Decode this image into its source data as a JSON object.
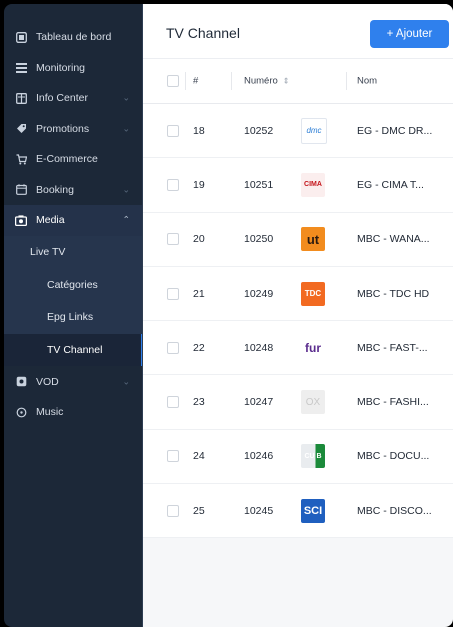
{
  "sidebar": {
    "items": [
      {
        "label": "Tableau de bord",
        "icon": "dashboard-icon",
        "chevron": false
      },
      {
        "label": "Monitoring",
        "icon": "list-icon",
        "chevron": false
      },
      {
        "label": "Info Center",
        "icon": "info-center-icon",
        "chevron": true
      },
      {
        "label": "Promotions",
        "icon": "tag-icon",
        "chevron": true
      },
      {
        "label": "E-Commerce",
        "icon": "cart-icon",
        "chevron": false
      },
      {
        "label": "Booking",
        "icon": "calendar-icon",
        "chevron": true
      },
      {
        "label": "Media",
        "icon": "media-icon",
        "chevron": true,
        "active": true
      }
    ],
    "media_sub": {
      "live_tv": "Live TV",
      "children": [
        "Catégories",
        "Epg Links",
        "TV Channel"
      ]
    },
    "bottom_items": [
      {
        "label": "VOD",
        "icon": "vod-icon",
        "chevron": true
      },
      {
        "label": "Music",
        "icon": "music-icon",
        "chevron": false
      }
    ]
  },
  "header": {
    "title": "TV Channel",
    "add_label": "+ Ajouter"
  },
  "table": {
    "columns": {
      "idx": "#",
      "numero": "Numéro",
      "nom": "Nom"
    },
    "rows": [
      {
        "idx": "18",
        "numero": "10252",
        "nom": "EG - DMC DR...",
        "logo": "dmc"
      },
      {
        "idx": "19",
        "numero": "10251",
        "nom": "EG - CIMA T...",
        "logo": "cima"
      },
      {
        "idx": "20",
        "numero": "10250",
        "nom": "MBC - WANA...",
        "logo": "wanasah"
      },
      {
        "idx": "21",
        "numero": "10249",
        "nom": "MBC - TDC HD",
        "logo": "tdc"
      },
      {
        "idx": "22",
        "numero": "10248",
        "nom": "MBC - FAST-...",
        "logo": "fast"
      },
      {
        "idx": "23",
        "numero": "10247",
        "nom": "MBC - FASHI...",
        "logo": "fashion"
      },
      {
        "idx": "24",
        "numero": "10246",
        "nom": "MBC - DOCU...",
        "logo": "docu"
      },
      {
        "idx": "25",
        "numero": "10245",
        "nom": "MBC - DISCO...",
        "logo": "disco"
      }
    ],
    "logo_text": {
      "dmc": "dmc",
      "cima": "CIMA",
      "wanasah": "ut",
      "tdc": "TDC",
      "fast": "fur",
      "fashion": "OX",
      "docu": "CU B",
      "disco": "SCI"
    }
  },
  "colors": {
    "sidebar_bg": "#1c2838",
    "submenu_bg": "#26354d",
    "accent": "#2f80ed"
  }
}
